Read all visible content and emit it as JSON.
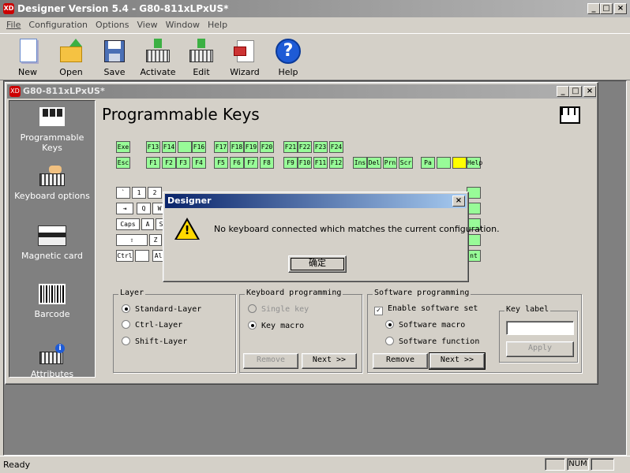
{
  "app": {
    "title": "Designer Version 5.4 - G80-811xLPxUS*"
  },
  "menu": [
    "File",
    "Configuration",
    "Options",
    "View",
    "Window",
    "Help"
  ],
  "toolbar": [
    {
      "label": "New",
      "icon": "new-document-icon"
    },
    {
      "label": "Open",
      "icon": "open-folder-icon"
    },
    {
      "label": "Save",
      "icon": "save-disk-icon"
    },
    {
      "label": "Activate",
      "icon": "keyboard-activate-icon"
    },
    {
      "label": "Edit",
      "icon": "keyboard-edit-icon"
    },
    {
      "label": "Wizard",
      "icon": "wizard-icon"
    },
    {
      "label": "Help",
      "icon": "help-question-icon"
    }
  ],
  "child": {
    "title": "G80-811xLPxUS*"
  },
  "sidebar": [
    {
      "label": "Programmable Keys",
      "icon": "keyboard-grid-icon"
    },
    {
      "label": "Keyboard options",
      "icon": "keyboard-hand-icon"
    },
    {
      "label": "Magnetic card",
      "icon": "magnetic-card-icon"
    },
    {
      "label": "Barcode",
      "icon": "barcode-icon"
    },
    {
      "label": "Attributes",
      "icon": "keyboard-info-icon"
    }
  ],
  "page": {
    "title": "Programmable Keys"
  },
  "keys": {
    "row1": [
      "Exe",
      "F13",
      "F14",
      "",
      "F16",
      "F17",
      "F18",
      "F19",
      "F20",
      "F21",
      "F22",
      "F23",
      "F24"
    ],
    "row2": [
      "Esc",
      "F1",
      "F2",
      "F3",
      "F4",
      "F5",
      "F6",
      "F7",
      "F8",
      "F9",
      "F10",
      "F11",
      "F12",
      "Ins",
      "Del",
      "Prn",
      "Scr",
      "Pa",
      "",
      "",
      "Help"
    ],
    "main": [
      "`",
      "1",
      "2",
      "⇥",
      "Q",
      "W",
      "Caps",
      "A",
      "S",
      "⇧",
      "Z",
      "Ctrl",
      "Alt",
      "nt"
    ]
  },
  "layer": {
    "title": "Layer",
    "options": [
      "Standard-Layer",
      "Ctrl-Layer",
      "Shift-Layer"
    ],
    "selected": "Standard-Layer"
  },
  "keyboard_programming": {
    "title": "Keyboard programming",
    "options": [
      "Single key",
      "Key macro"
    ],
    "selected": "Key macro",
    "remove": "Remove",
    "next": "Next >>"
  },
  "software_programming": {
    "title": "Software programming",
    "enable": "Enable software set",
    "enable_checked": true,
    "options": [
      "Software macro",
      "Software function"
    ],
    "selected": "Software macro",
    "remove": "Remove",
    "next": "Next >>"
  },
  "key_label": {
    "title": "Key label",
    "value": "",
    "apply": "Apply"
  },
  "dialog": {
    "title": "Designer",
    "message": "No keyboard connected which matches the current configuration.",
    "ok": "确定"
  },
  "status": {
    "text": "Ready",
    "num": "NUM"
  }
}
